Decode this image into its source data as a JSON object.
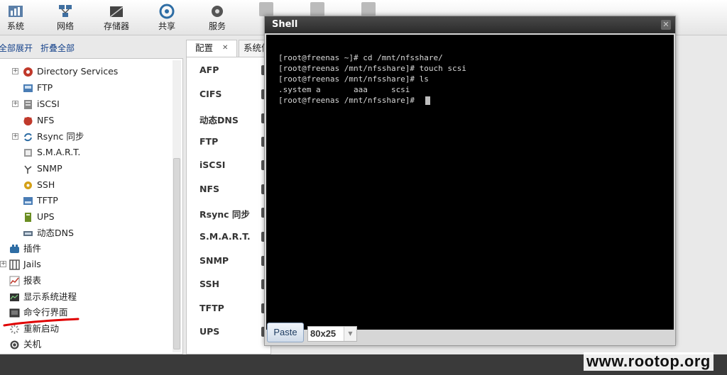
{
  "toolbar": {
    "items": [
      {
        "label": "系统",
        "icon": "system-icon"
      },
      {
        "label": "网络",
        "icon": "network-icon"
      },
      {
        "label": "存储器",
        "icon": "storage-icon"
      },
      {
        "label": "共享",
        "icon": "sharing-icon"
      },
      {
        "label": "服务",
        "icon": "services-icon"
      }
    ]
  },
  "tree": {
    "expand_all": "全部展开",
    "collapse_all": "折叠全部",
    "items": [
      {
        "label": "Directory Services",
        "icon": "directory-services-icon"
      },
      {
        "label": "FTP",
        "icon": "ftp-icon"
      },
      {
        "label": "iSCSI",
        "icon": "iscsi-icon"
      },
      {
        "label": "NFS",
        "icon": "nfs-icon"
      },
      {
        "label": "Rsync 同步",
        "icon": "rsync-icon"
      },
      {
        "label": "S.M.A.R.T.",
        "icon": "smart-icon"
      },
      {
        "label": "SNMP",
        "icon": "snmp-icon"
      },
      {
        "label": "SSH",
        "icon": "ssh-icon"
      },
      {
        "label": "TFTP",
        "icon": "tftp-icon"
      },
      {
        "label": "UPS",
        "icon": "ups-icon"
      },
      {
        "label": "动态DNS",
        "icon": "dynamic-dns-icon"
      },
      {
        "label": "插件",
        "icon": "plugins-icon"
      },
      {
        "label": "Jails",
        "icon": "jails-icon"
      },
      {
        "label": "报表",
        "icon": "reports-icon"
      },
      {
        "label": "显示系统进程",
        "icon": "processes-icon"
      },
      {
        "label": "命令行界面",
        "icon": "shell-icon"
      },
      {
        "label": "重新启动",
        "icon": "reboot-icon"
      },
      {
        "label": "关机",
        "icon": "shutdown-icon"
      }
    ]
  },
  "services_panel": {
    "tabs": [
      {
        "label": "配置"
      },
      {
        "label": "系统信"
      }
    ],
    "tab_close": "✕",
    "items": [
      {
        "label": "AFP"
      },
      {
        "label": "CIFS"
      },
      {
        "label": "动态DNS"
      },
      {
        "label": "FTP"
      },
      {
        "label": "iSCSI"
      },
      {
        "label": "NFS"
      },
      {
        "label": "Rsync 同步"
      },
      {
        "label": "S.M.A.R.T."
      },
      {
        "label": "SNMP"
      },
      {
        "label": "SSH"
      },
      {
        "label": "TFTP"
      },
      {
        "label": "UPS"
      }
    ]
  },
  "shell": {
    "title": "Shell",
    "close_symbol": "✕",
    "lines": [
      "[root@freenas ~]# cd /mnt/nfsshare/",
      "[root@freenas /mnt/nfsshare]# touch scsi",
      "[root@freenas /mnt/nfsshare]# ls",
      ".system a       aaa     scsi",
      "[root@freenas /mnt/nfsshare]# "
    ],
    "paste_label": "Paste",
    "size_value": "80x25",
    "size_arrow": "▼"
  },
  "watermark": "www.rootop.org",
  "colors": {
    "terminal_bg": "#000000",
    "terminal_fg": "#d8d8d8",
    "annotation_red": "#e00000",
    "title_bar": "#333333"
  }
}
